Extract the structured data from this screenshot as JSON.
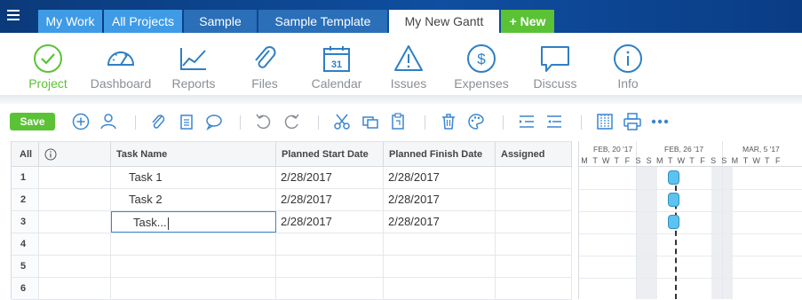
{
  "tabs": [
    {
      "label": "My Work"
    },
    {
      "label": "All Projects"
    },
    {
      "label": "Sample"
    },
    {
      "label": "Sample Template"
    },
    {
      "label": "My New Gantt"
    },
    {
      "label": "+ New"
    }
  ],
  "nav": [
    {
      "label": "Project",
      "icon": "check-circle-icon"
    },
    {
      "label": "Dashboard",
      "icon": "speedometer-icon"
    },
    {
      "label": "Reports",
      "icon": "line-chart-icon"
    },
    {
      "label": "Files",
      "icon": "paperclip-icon"
    },
    {
      "label": "Calendar",
      "icon": "calendar-icon",
      "day": "31"
    },
    {
      "label": "Issues",
      "icon": "warning-icon"
    },
    {
      "label": "Expenses",
      "icon": "dollar-icon"
    },
    {
      "label": "Discuss",
      "icon": "speech-bubble-icon"
    },
    {
      "label": "Info",
      "icon": "info-icon"
    }
  ],
  "toolbar": {
    "save_label": "Save"
  },
  "grid": {
    "headers": {
      "all": "All",
      "task_name": "Task Name",
      "start": "Planned Start Date",
      "finish": "Planned Finish Date",
      "assigned": "Assigned"
    },
    "rows": [
      {
        "num": "1",
        "task": "Task 1",
        "start": "2/28/2017",
        "finish": "2/28/2017",
        "assigned": ""
      },
      {
        "num": "2",
        "task": "Task 2",
        "start": "2/28/2017",
        "finish": "2/28/2017",
        "assigned": ""
      },
      {
        "num": "3",
        "task": "Task...",
        "start": "2/28/2017",
        "finish": "2/28/2017",
        "assigned": ""
      },
      {
        "num": "4",
        "task": "",
        "start": "",
        "finish": "",
        "assigned": ""
      },
      {
        "num": "5",
        "task": "",
        "start": "",
        "finish": "",
        "assigned": ""
      },
      {
        "num": "6",
        "task": "",
        "start": "",
        "finish": "",
        "assigned": ""
      }
    ]
  },
  "gantt": {
    "weeks": [
      "FEB, 20 '17",
      "FEB, 26 '17",
      "MAR, 5 '17"
    ],
    "days": [
      "M",
      "T",
      "W",
      "T",
      "F",
      "S",
      "S",
      "M",
      "T",
      "W",
      "T",
      "F",
      "S",
      "S",
      "M",
      "T",
      "W",
      "T",
      "F"
    ]
  },
  "colors": {
    "accent_green": "#5bc236",
    "brand_blue": "#0f4ea0",
    "milestone": "#5cc3ef"
  }
}
